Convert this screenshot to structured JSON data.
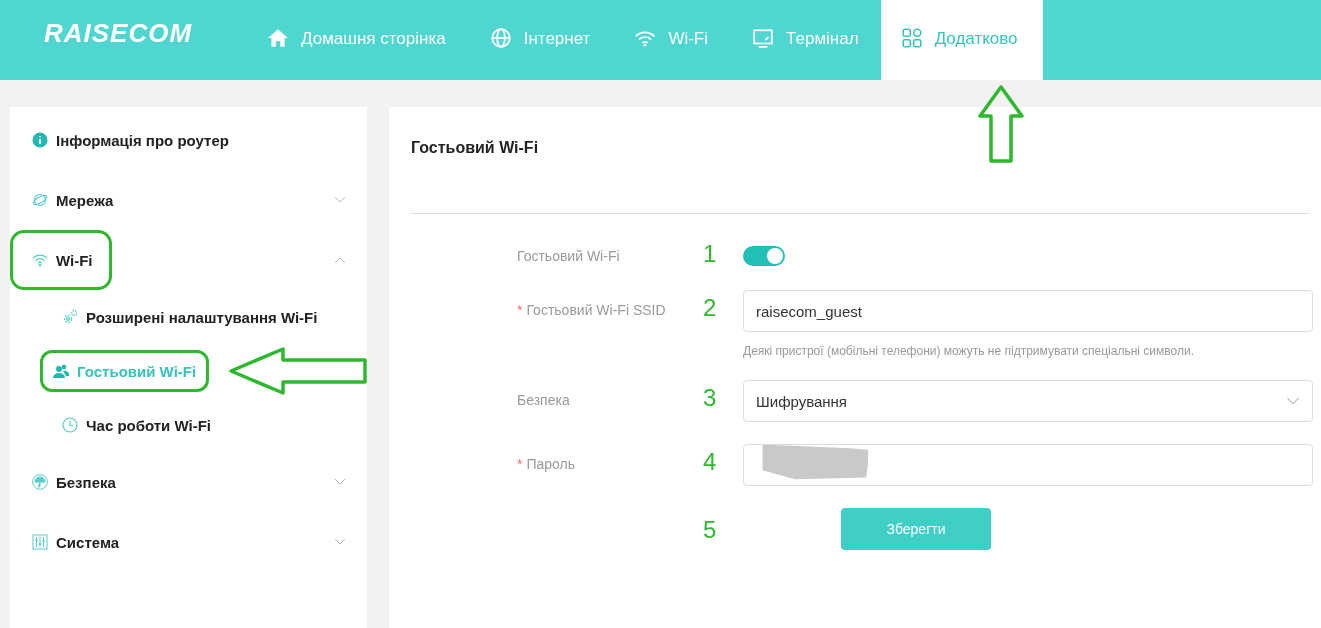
{
  "header": {
    "logo": "RAISECOM",
    "nav": [
      {
        "label": "Домашня сторінка",
        "selected": false
      },
      {
        "label": "Інтернет",
        "selected": false
      },
      {
        "label": "Wi-Fi",
        "selected": false
      },
      {
        "label": "Термінал",
        "selected": false
      },
      {
        "label": "Додатково",
        "selected": true
      }
    ]
  },
  "sidebar": {
    "items": [
      {
        "label": "Інформація про роутер",
        "highlighted": false
      },
      {
        "label": "Мережа",
        "expanded": false,
        "highlighted": false
      },
      {
        "label": "Wi-Fi",
        "expanded": true,
        "highlighted": true,
        "children": [
          {
            "label": "Розширені налаштування Wi-Fi",
            "selected": false,
            "highlighted": false
          },
          {
            "label": "Гостьовий Wi-Fi",
            "selected": true,
            "highlighted": true
          },
          {
            "label": "Час роботи Wi-Fi",
            "selected": false,
            "highlighted": false
          }
        ]
      },
      {
        "label": "Безпека",
        "expanded": false,
        "highlighted": false
      },
      {
        "label": "Система",
        "expanded": false,
        "highlighted": false
      }
    ]
  },
  "panel": {
    "title": "Гостьовий Wi-Fi",
    "fields": [
      {
        "kind": "toggle",
        "label": "Гостьовий Wi-Fi",
        "on": true,
        "marker": "1"
      },
      {
        "kind": "input",
        "required_mark": "*",
        "label": "Гостьовий Wi-Fi SSID",
        "value": "raisecom_guest",
        "hint": "Деякі пристрої (мобільні телефони) можуть не підтримувати спеціальні символи.",
        "marker": "2"
      },
      {
        "kind": "select",
        "label": "Безпека",
        "value": "Шифрування",
        "marker": "3"
      },
      {
        "kind": "redacted",
        "required_mark": "*",
        "label": "Пароль",
        "marker": "4"
      }
    ],
    "save_button": {
      "label": "Зберегти",
      "marker": "5"
    }
  }
}
